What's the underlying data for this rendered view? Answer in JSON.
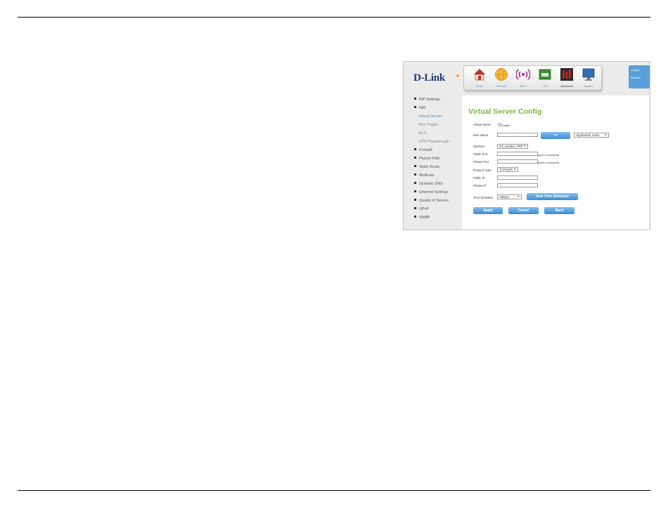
{
  "brand": {
    "logo_text": "D-Link",
    "accent": "#79b83d",
    "nav_blue": "#3f8ad6"
  },
  "nav": [
    {
      "label": "Home",
      "icon": "home-icon"
    },
    {
      "label": "Internet",
      "icon": "globe-icon"
    },
    {
      "label": "Wi-Fi",
      "icon": "wifi-icon"
    },
    {
      "label": "LAN",
      "icon": "lan-icon"
    },
    {
      "label": "Advanced",
      "icon": "advanced-icon",
      "active": true
    },
    {
      "label": "System",
      "icon": "monitor-icon"
    }
  ],
  "logout": {
    "line1": "Logout",
    "line2": "Refresh"
  },
  "sidebar": {
    "items": [
      {
        "label": "RIP Settings"
      },
      {
        "label": "NAT"
      },
      {
        "label": "-Virtual Server",
        "sub": true,
        "active": true
      },
      {
        "label": "-Port Trigger",
        "sub": true
      },
      {
        "label": "-ALG",
        "sub": true
      },
      {
        "label": "-VPN Passthrough",
        "sub": true
      },
      {
        "label": "Firewall"
      },
      {
        "label": "Packet Filter"
      },
      {
        "label": "Static Route"
      },
      {
        "label": "Multicast"
      },
      {
        "label": "Dynamic DNS"
      },
      {
        "label": "Ethernet Settings"
      },
      {
        "label": "Quality of Service"
      },
      {
        "label": "UPnP"
      },
      {
        "label": "SNMP"
      }
    ]
  },
  "form": {
    "title": "Virtual Server Config",
    "virtual_server_label": "Virtual Server",
    "enable_label": "Enable",
    "rule_name_label": "Rule Name",
    "rule_name_value": "",
    "copy_button": "<<",
    "app_select": "Application name",
    "interface_label": "Interface",
    "interface_value": "3G_Modem_PPP",
    "public_port_label": "Public Port",
    "public_port_value": "",
    "port_hint": "(port or port:port)",
    "private_port_label": "Private Port",
    "private_port_value": "",
    "protocol_label": "Protocol Type",
    "protocol_value": "TCP/UDP",
    "public_ip_label": "Public IP",
    "public_ip_value": "",
    "private_ip_label": "Private IP",
    "private_ip_value": "",
    "schedule_label": "Time Schedule",
    "schedule_value": "Always",
    "new_schedule_button": "New Time Schedule",
    "apply_button": "Apply",
    "cancel_button": "Cancel",
    "back_button": "Back"
  }
}
